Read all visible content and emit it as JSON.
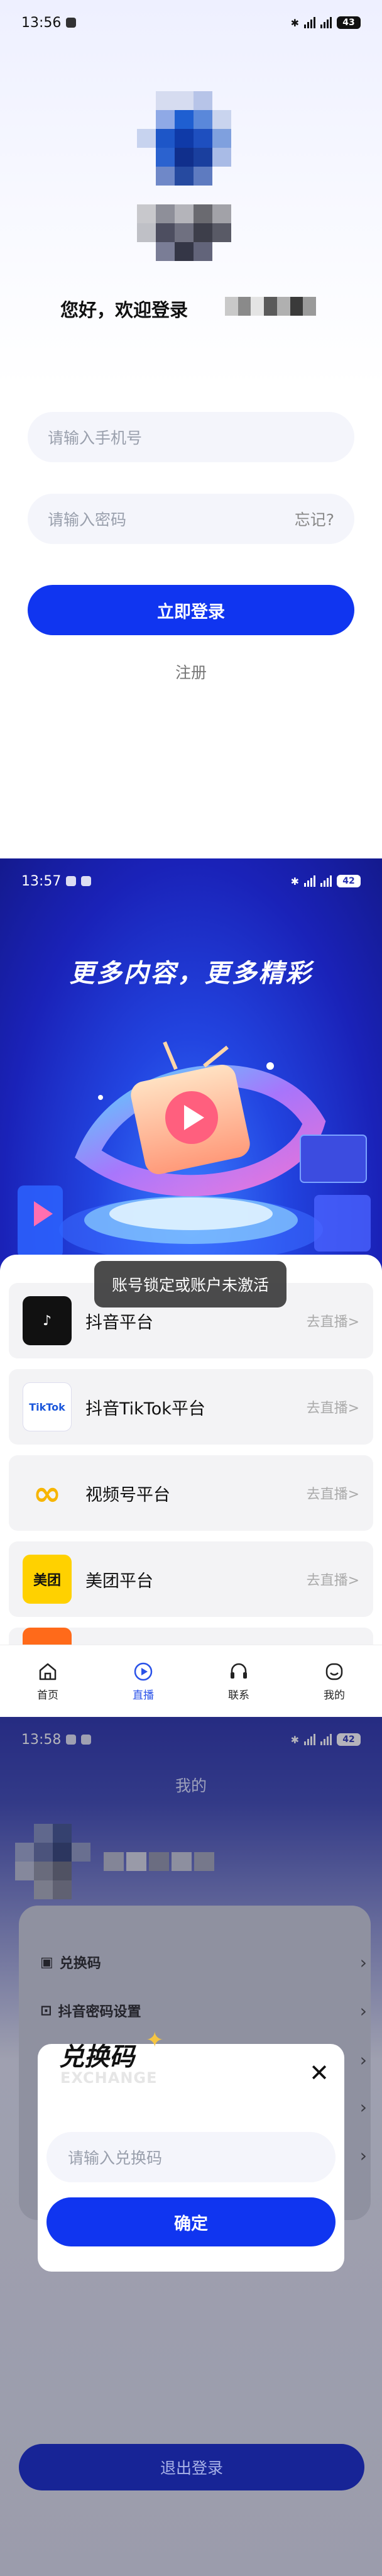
{
  "screen1": {
    "status_time": "13:56",
    "battery": "43",
    "greeting": "您好，欢迎登录",
    "phone_placeholder": "请输入手机号",
    "password_placeholder": "请输入密码",
    "forgot": "忘记?",
    "login_button": "立即登录",
    "register": "注册"
  },
  "screen2": {
    "status_time": "13:57",
    "battery": "42",
    "banner_title": "更多内容，更多精彩",
    "toast": "账号锁定或账户未激活",
    "platforms": [
      {
        "name": "抖音平台",
        "action": "去直播>",
        "logo_text": "♪",
        "logo_color": "#111111"
      },
      {
        "name": "抖音TikTok平台",
        "action": "去直播>",
        "logo_text": "TikTok",
        "logo_color": "#1a56db"
      },
      {
        "name": "视频号平台",
        "action": "去直播>",
        "logo_text": "∞",
        "logo_color": "#f7b500"
      },
      {
        "name": "美团平台",
        "action": "去直播>",
        "logo_text": "美团",
        "logo_color": "#ffd100"
      }
    ],
    "tabs": [
      {
        "label": "首页",
        "icon": "home-icon"
      },
      {
        "label": "直播",
        "icon": "live-icon"
      },
      {
        "label": "联系",
        "icon": "headset-icon"
      },
      {
        "label": "我的",
        "icon": "profile-icon"
      }
    ],
    "active_tab": "直播"
  },
  "screen3": {
    "status_time": "13:58",
    "battery": "42",
    "page_title": "我的",
    "menu_items": [
      {
        "label": "兑换码"
      },
      {
        "label": "抖音密码设置"
      }
    ],
    "modal": {
      "title": "兑换码",
      "subtitle": "EXCHANGE",
      "input_placeholder": "请输入兑换码",
      "confirm": "确定"
    },
    "logout": "退出登录"
  },
  "colors": {
    "primary": "#1035f0",
    "banner": "#2244e0",
    "active_tab": "#2a52e8"
  }
}
